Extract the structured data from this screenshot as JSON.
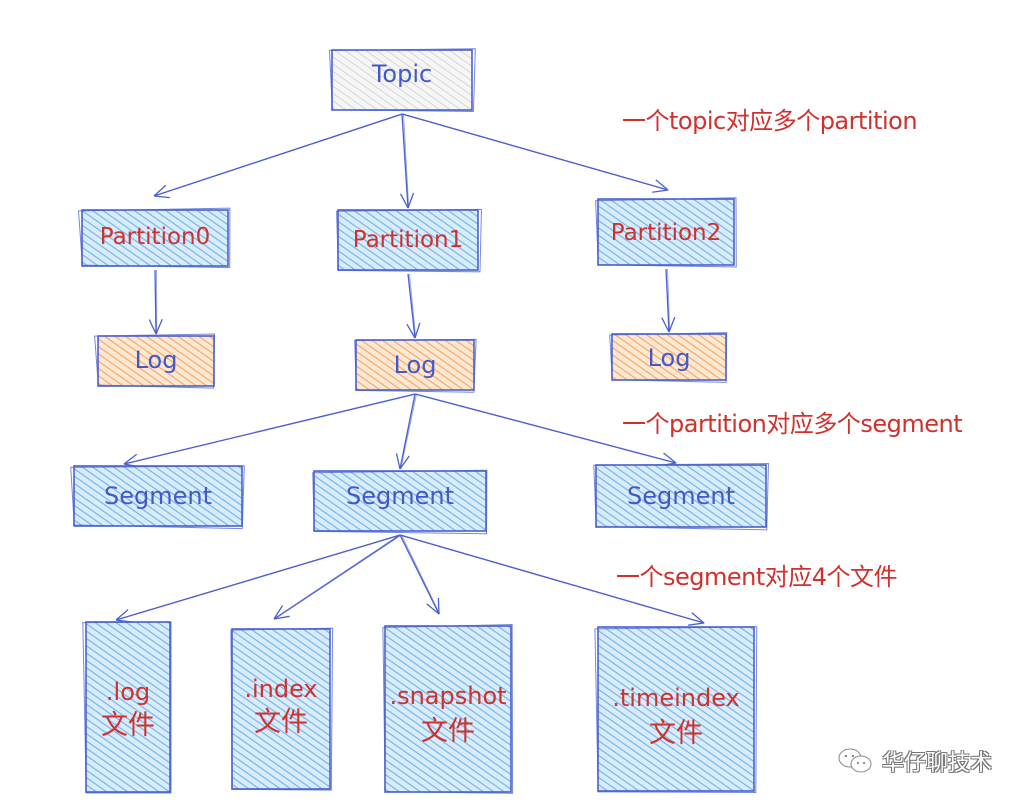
{
  "diagram": {
    "colors": {
      "stroke": "#4a60d0",
      "hatch_blue": "#6fb2ec",
      "fill_blue": "#d8ecfb",
      "hatch_orange": "#f7a55d",
      "fill_orange": "#fde8d4",
      "hatch_gray": "#c8c8c8",
      "fill_gray": "#f4f4f4",
      "text_blue": "#4459c8",
      "text_red": "#d0312d"
    },
    "nodes": {
      "topic": {
        "label": "Topic",
        "style": "gray"
      },
      "partitions": [
        {
          "label": "Partition0",
          "style": "blue"
        },
        {
          "label": "Partition1",
          "style": "blue"
        },
        {
          "label": "Partition2",
          "style": "blue"
        }
      ],
      "logs": [
        {
          "label": "Log",
          "style": "orange"
        },
        {
          "label": "Log",
          "style": "orange"
        },
        {
          "label": "Log",
          "style": "orange"
        }
      ],
      "segments": [
        {
          "label": "Segment",
          "style": "blue"
        },
        {
          "label": "Segment",
          "style": "blue"
        },
        {
          "label": "Segment",
          "style": "blue"
        }
      ],
      "files": [
        {
          "line1": ".log",
          "line2": "文件",
          "style": "blue"
        },
        {
          "line1": ".index",
          "line2": "文件",
          "style": "blue"
        },
        {
          "line1": ".snapshot",
          "line2": "文件",
          "style": "blue"
        },
        {
          "line1": ".timeindex",
          "line2": "文件",
          "style": "blue"
        }
      ]
    },
    "edges": [
      [
        "topic",
        "partition0"
      ],
      [
        "topic",
        "partition1"
      ],
      [
        "topic",
        "partition2"
      ],
      [
        "partition0",
        "log0"
      ],
      [
        "partition1",
        "log1"
      ],
      [
        "partition2",
        "log2"
      ],
      [
        "log1",
        "segment0"
      ],
      [
        "log1",
        "segment1"
      ],
      [
        "log1",
        "segment2"
      ],
      [
        "segment1",
        "file0"
      ],
      [
        "segment1",
        "file1"
      ],
      [
        "segment1",
        "file2"
      ],
      [
        "segment1",
        "file3"
      ]
    ],
    "annotations": [
      "一个topic对应多个partition",
      "一个partition对应多个segment",
      "一个segment对应4个文件"
    ]
  },
  "watermark": {
    "icon": "wechat-icon",
    "text": "华仔聊技术"
  }
}
